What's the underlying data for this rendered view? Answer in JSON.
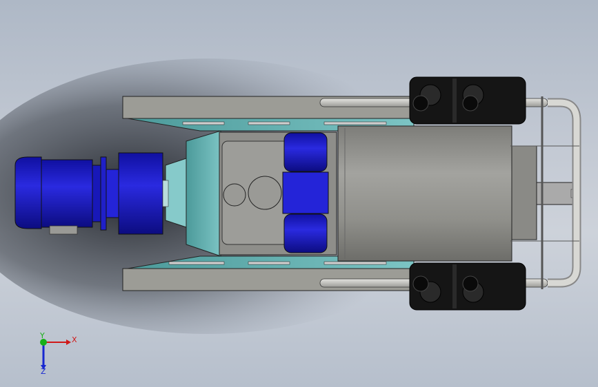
{
  "viewport": {
    "background_top": "#aeb8c6",
    "background_bottom": "#b6bfcc"
  },
  "colors": {
    "frame_gray": "#9a9a94",
    "teal_plate": "#5fa8a8",
    "motor_blue": "#1f1fc8",
    "track_black": "#1a1a1a",
    "rail_silver": "#c8c8c4"
  },
  "triad": {
    "x_label": "X",
    "y_label": "Y",
    "z_label": "Z",
    "x_color": "#d01818",
    "y_color": "#18b018",
    "z_color": "#1828d0"
  }
}
